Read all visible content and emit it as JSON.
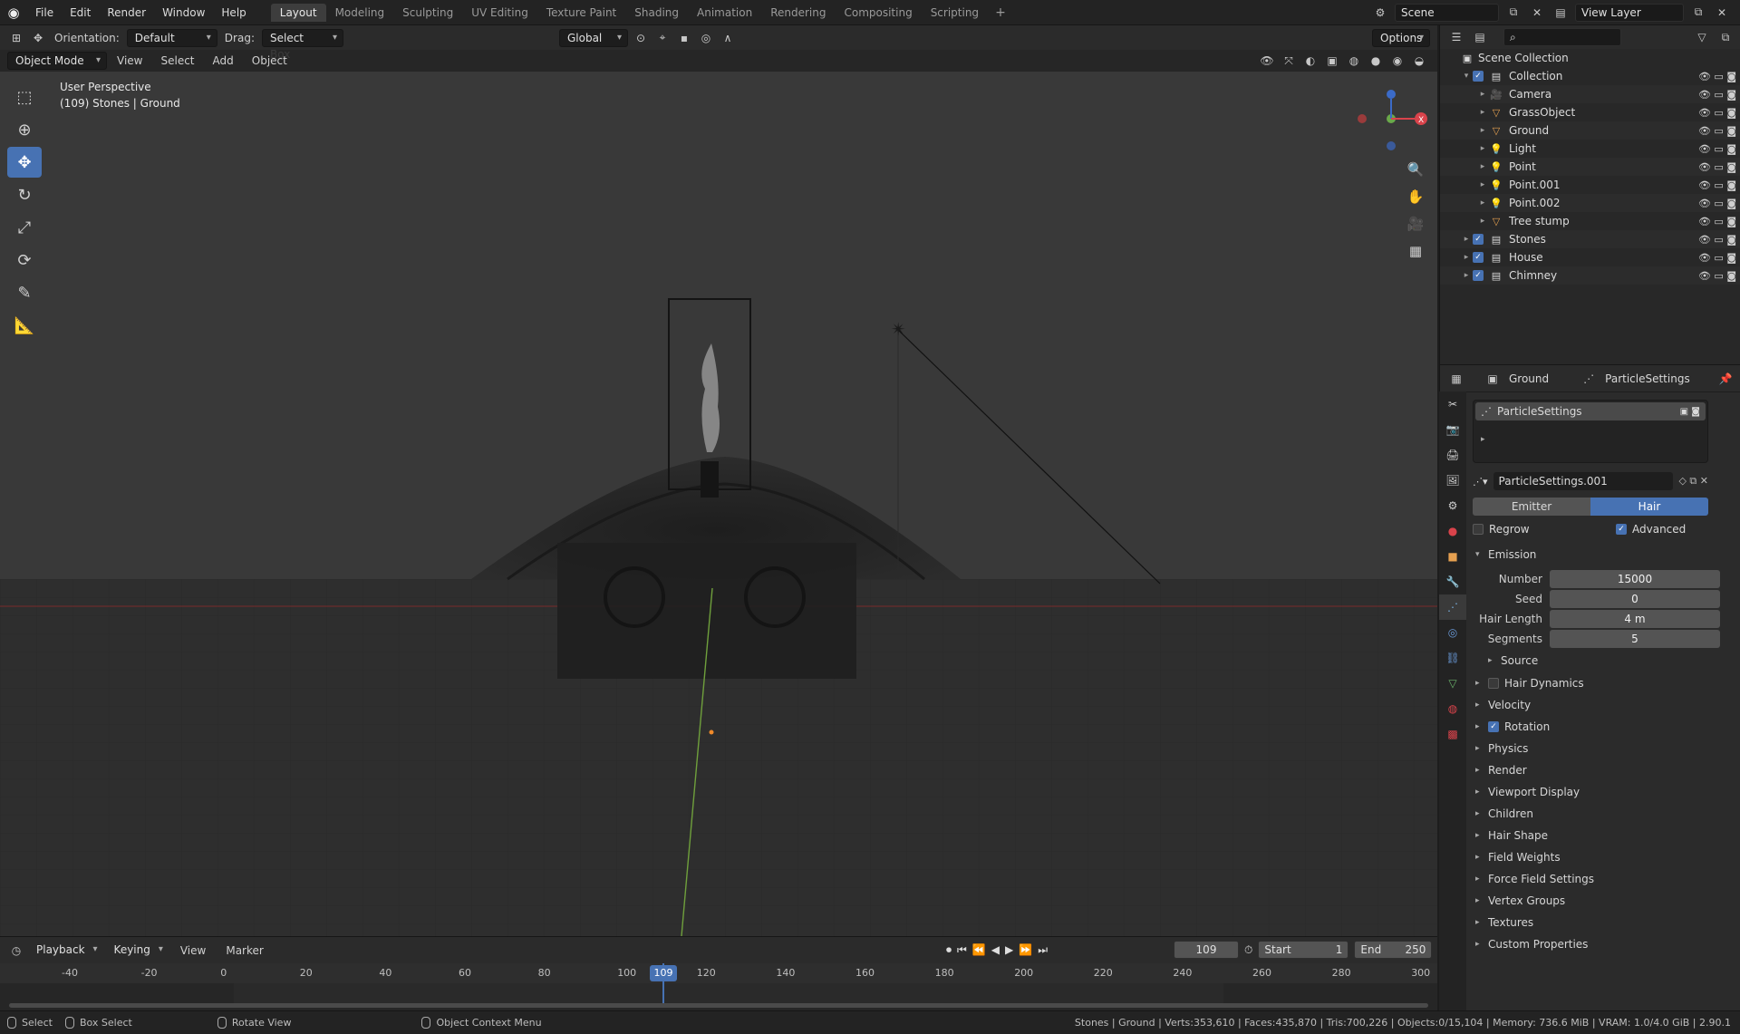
{
  "topbar": {
    "menus": [
      "File",
      "Edit",
      "Render",
      "Window",
      "Help"
    ],
    "workspaces": [
      "Layout",
      "Modeling",
      "Sculpting",
      "UV Editing",
      "Texture Paint",
      "Shading",
      "Animation",
      "Rendering",
      "Compositing",
      "Scripting"
    ],
    "active_workspace": "Layout",
    "scene": "Scene",
    "view_layer": "View Layer"
  },
  "toolrow": {
    "orientation_label": "Orientation:",
    "orientation_value": "Default",
    "drag_label": "Drag:",
    "drag_value": "Select Box",
    "transform_orientation": "Global",
    "options": "Options"
  },
  "viewport_header": {
    "mode": "Object Mode",
    "menus": [
      "View",
      "Select",
      "Add",
      "Object"
    ]
  },
  "viewport": {
    "perspective": "User Perspective",
    "selection_info": "(109) Stones | Ground"
  },
  "outliner": {
    "root": "Scene Collection",
    "items": [
      {
        "name": "Collection",
        "depth": 1,
        "kind": "collection"
      },
      {
        "name": "Camera",
        "depth": 2,
        "kind": "object"
      },
      {
        "name": "GrassObject",
        "depth": 2,
        "kind": "object"
      },
      {
        "name": "Ground",
        "depth": 2,
        "kind": "object"
      },
      {
        "name": "Light",
        "depth": 2,
        "kind": "object"
      },
      {
        "name": "Point",
        "depth": 2,
        "kind": "object"
      },
      {
        "name": "Point.001",
        "depth": 2,
        "kind": "object"
      },
      {
        "name": "Point.002",
        "depth": 2,
        "kind": "object"
      },
      {
        "name": "Tree stump",
        "depth": 2,
        "kind": "object"
      },
      {
        "name": "Stones",
        "depth": 1,
        "kind": "collection"
      },
      {
        "name": "House",
        "depth": 1,
        "kind": "collection"
      },
      {
        "name": "Chimney",
        "depth": 1,
        "kind": "collection"
      }
    ]
  },
  "properties": {
    "object": "Ground",
    "context": "ParticleSettings",
    "system_name": "ParticleSettings",
    "settings_name": "ParticleSettings.001",
    "type_emitter": "Emitter",
    "type_hair": "Hair",
    "regrow": "Regrow",
    "advanced": "Advanced",
    "emission_panel": "Emission",
    "fields": [
      {
        "label": "Number",
        "value": "15000"
      },
      {
        "label": "Seed",
        "value": "0"
      },
      {
        "label": "Hair Length",
        "value": "4 m"
      },
      {
        "label": "Segments",
        "value": "5"
      }
    ],
    "source": "Source",
    "panels": [
      "Hair Dynamics",
      "Velocity",
      "Rotation",
      "Physics",
      "Render",
      "Viewport Display",
      "Children",
      "Hair Shape",
      "Field Weights",
      "Force Field Settings",
      "Vertex Groups",
      "Textures",
      "Custom Properties"
    ]
  },
  "timeline": {
    "menus": [
      "Playback",
      "Keying",
      "View",
      "Marker"
    ],
    "current_frame": "109",
    "start_label": "Start",
    "start": "1",
    "end_label": "End",
    "end": "250",
    "ticks": [
      "-40",
      "-20",
      "0",
      "20",
      "40",
      "60",
      "80",
      "100",
      "120",
      "140",
      "160",
      "180",
      "200",
      "220",
      "240",
      "260",
      "280",
      "300"
    ]
  },
  "status": {
    "select": "Select",
    "box_select": "Box Select",
    "rotate_view": "Rotate View",
    "context_menu": "Object Context Menu",
    "stats": "Stones | Ground | Verts:353,610 | Faces:435,870 | Tris:700,226 | Objects:0/15,104 | Memory: 736.6 MiB | VRAM: 1.0/4.0 GiB | 2.90.1"
  },
  "colors": {
    "accent": "#4772b3",
    "object_orange": "#e5a050",
    "data_green": "#6ab06a"
  }
}
